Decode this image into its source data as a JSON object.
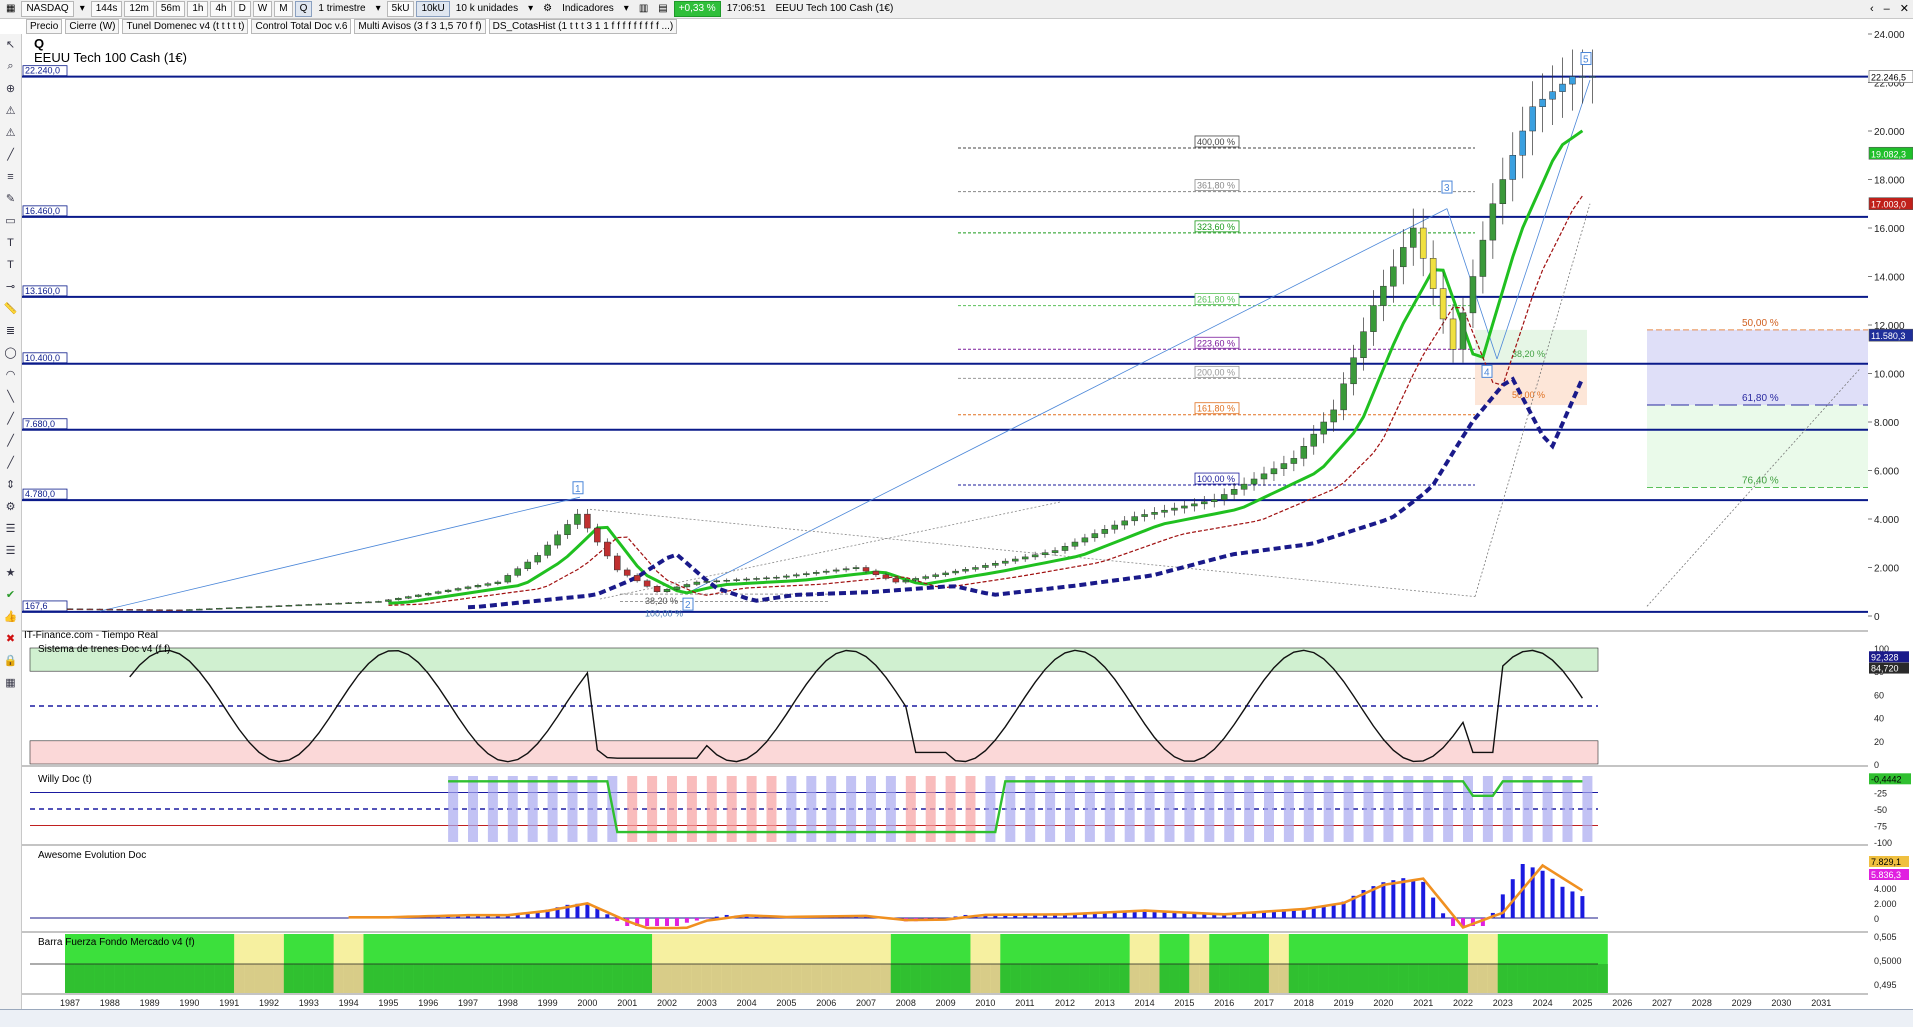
{
  "toolbar": {
    "market": "NASDAQ",
    "timeframes": [
      "144s",
      "12m",
      "56m",
      "1h",
      "4h",
      "D",
      "W",
      "M",
      "Q"
    ],
    "active_timeframe": "Q",
    "period": "1 trimestre",
    "units_a": "5kU",
    "units_b": "10kU",
    "units_select": "10 k unidades",
    "indicators_label": "Indicadores",
    "change": "+0,33 %",
    "time": "17:06:51",
    "instrument": "EEUU Tech 100 Cash (1€)"
  },
  "indicator_tabs": [
    "Precio",
    "Cierre (W)",
    "Tunel Domenec v4 (t t t t t)",
    "Control Total Doc v.6",
    "Multi Avisos (3 f 3 1,5 70 f f)",
    "DS_CotasHist (1 t t t 3 1 1 f f f f f f f f f ...)"
  ],
  "chart": {
    "title_symbol": "Q",
    "title": "EEUU Tech 100 Cash (1€)",
    "source": "IT-Finance.com - Tiempo Real",
    "level_labels": [
      "22.240,0",
      "16.460,0",
      "13.160,0",
      "10.400,0",
      "7.680,0",
      "4.780,0",
      "167,6"
    ],
    "price_axis": [
      "24.000",
      "22.000",
      "20.000",
      "18.000",
      "16.000",
      "14.000",
      "12.000",
      "10.000",
      "8.000",
      "6.000",
      "4.000",
      "2.000",
      "0"
    ],
    "price_badges": [
      {
        "text": "22.246,5",
        "color": "#ffffff"
      },
      {
        "text": "19.082,3",
        "color": "#1fbf2a"
      },
      {
        "text": "17.003,0",
        "color": "#c0201a"
      },
      {
        "text": "11.580,3",
        "color": "#1f2f9a"
      }
    ],
    "fib_labels": [
      "400,00 %",
      "361,80 %",
      "323,60 %",
      "261,80 %",
      "223,60 %",
      "200,00 %",
      "161,80 %",
      "100,00 %"
    ],
    "wave_labels": [
      "1",
      "2",
      "3",
      "4",
      "5"
    ],
    "retrace_labels": [
      "38,20 %",
      "50,00 %",
      "38,20 %",
      "100,00 %"
    ],
    "zone_labels": [
      "50,00 %",
      "61,80 %",
      "76,40 %"
    ]
  },
  "panels": {
    "trenes": {
      "title": "Sistema de trenes Doc v4 (f f)",
      "axis": [
        "100",
        "80",
        "60",
        "40",
        "20",
        "0"
      ],
      "badges": [
        "92,328",
        "84,720"
      ]
    },
    "willy": {
      "title": "Willy Doc (t)",
      "axis": [
        "-25",
        "-50",
        "-75",
        "-100"
      ],
      "badge": "-0,4442"
    },
    "awesome": {
      "title": "Awesome Evolution Doc",
      "axis": [
        "4.000",
        "2.000",
        "0"
      ],
      "badges": [
        "7.829,1",
        "5.836,3"
      ]
    },
    "barra": {
      "title": "Barra Fuerza Fondo Mercado v4 (f)",
      "axis": [
        "0,505",
        "0,5000",
        "0,495"
      ]
    }
  },
  "years": [
    "1987",
    "1988",
    "1989",
    "1990",
    "1991",
    "1992",
    "1993",
    "1994",
    "1995",
    "1996",
    "1997",
    "1998",
    "1999",
    "2000",
    "2001",
    "2002",
    "2003",
    "2004",
    "2005",
    "2006",
    "2007",
    "2008",
    "2009",
    "2010",
    "2011",
    "2012",
    "2013",
    "2014",
    "2015",
    "2016",
    "2017",
    "2018",
    "2019",
    "2020",
    "2021",
    "2022",
    "2023",
    "2024",
    "2025",
    "2026",
    "2027",
    "2028",
    "2029",
    "2030",
    "2031"
  ],
  "chart_data": {
    "type": "candlestick",
    "title": "EEUU Tech 100 Cash (1€)",
    "timeframe": "Quarterly",
    "x": [
      "1987",
      "1990",
      "1995",
      "1998",
      "1999",
      "2000",
      "2001",
      "2002",
      "2003",
      "2005",
      "2007",
      "2008",
      "2009",
      "2010",
      "2012",
      "2014",
      "2016",
      "2018",
      "2019",
      "2020",
      "2021",
      "2022",
      "2023",
      "2024",
      "2025"
    ],
    "close_approx": [
      300,
      250,
      600,
      1400,
      2500,
      4200,
      1900,
      1000,
      1400,
      1600,
      2000,
      1400,
      1700,
      2000,
      2700,
      4100,
      4800,
      6500,
      8500,
      12800,
      16000,
      11000,
      17000,
      21000,
      22246
    ],
    "horizontal_levels": [
      22240,
      16460,
      13160,
      10400,
      7680,
      4780,
      167.6
    ],
    "ylim": [
      0,
      24000
    ]
  }
}
